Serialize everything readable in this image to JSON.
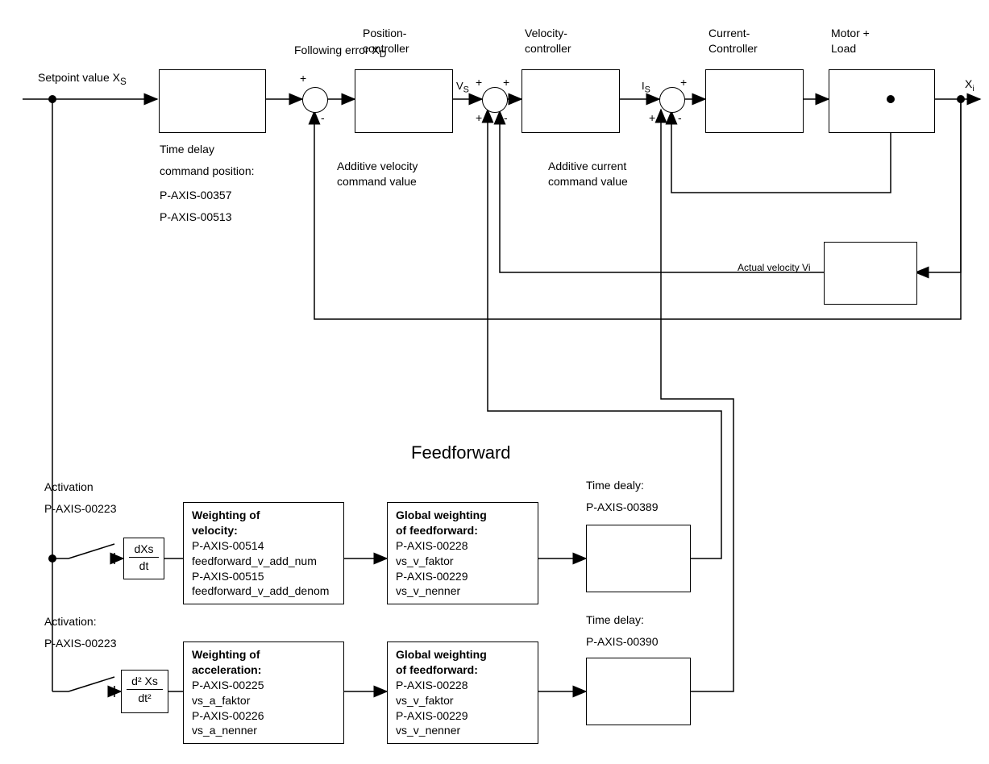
{
  "labels": {
    "setpoint": "Setpoint value X",
    "setpoint_sub": "S",
    "following_error": "Following error X",
    "following_error_sub": "D",
    "vs": "V",
    "vs_sub": "S",
    "is": "I",
    "is_sub": "S",
    "xi": "X",
    "xi_sub": "i",
    "position_ctrl": "Position-\ncontroller",
    "velocity_ctrl": "Velocity-\ncontroller",
    "current_ctrl": "Current-\nController",
    "motor_load": "Motor +\nLoad",
    "actual_velocity": "Actual velocity Vi",
    "td_block": {
      "l1": "Time delay",
      "l2": "command position:",
      "l3": "P-AXIS-00357",
      "l4": "P-AXIS-00513"
    },
    "add_vel": "Additive velocity\ncommand value",
    "add_cur": "Additive current\ncommand value",
    "ff_title": "Feedforward",
    "ff_vel": {
      "act": "Activation",
      "p": "P-AXIS-00223",
      "w_title": "Weighting of\nvelocity:",
      "w1": "P-AXIS-00514",
      "w2": "feedforward_v_add_num",
      "w3": "P-AXIS-00515",
      "w4": "feedforward_v_add_denom",
      "g_title": "Global weighting\nof feedforward:",
      "g1": "P-AXIS-00228",
      "g2": "vs_v_faktor",
      "g3": "P-AXIS-00229",
      "g4": "vs_v_nenner",
      "td_lbl": "Time dealy:",
      "td_p": "P-AXIS-00389"
    },
    "ff_acc": {
      "act": "Activation:",
      "p": "P-AXIS-00223",
      "w_title": "Weighting of\nacceleration:",
      "w1": "P-AXIS-00225",
      "w2": "vs_a_faktor",
      "w3": "P-AXIS-00226",
      "w4": "vs_a_nenner",
      "g_title": "Global weighting\nof feedforward:",
      "g1": "P-AXIS-00228",
      "g2": "vs_v_faktor",
      "g3": "P-AXIS-00229",
      "g4": "vs_v_nenner",
      "td_lbl": "Time delay:",
      "td_p": "P-AXIS-00390"
    },
    "plus": "+",
    "minus": "-",
    "deriv1_num": "dXs",
    "deriv1_den": "dt",
    "deriv2_num": "d² Xs",
    "deriv2_den": "dt²"
  }
}
